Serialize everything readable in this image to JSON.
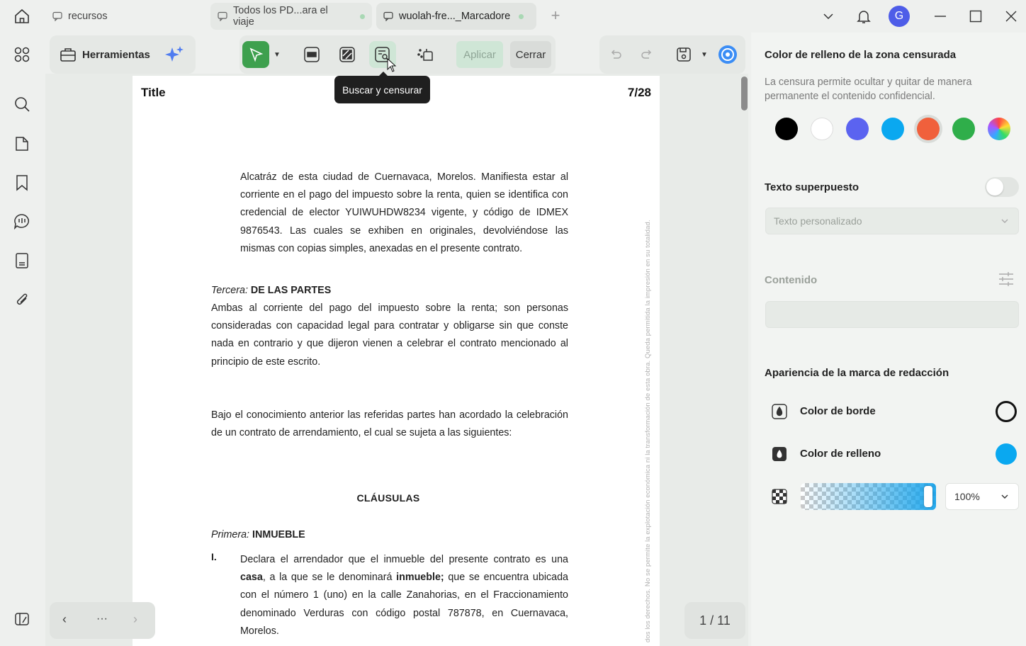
{
  "tabs": [
    {
      "label": "recursos"
    },
    {
      "label": "Todos los PD...ara el viaje"
    },
    {
      "label": "wuolah-fre..._Marcadore"
    }
  ],
  "user": {
    "avatar_letter": "G"
  },
  "toolbar": {
    "tools_label": "Herramientas",
    "apply_label": "Aplicar",
    "close_label": "Cerrar",
    "tooltip": "Buscar y censurar"
  },
  "document": {
    "header_title": "Title",
    "header_page": "7/28",
    "p1": "Alcatráz de esta ciudad de Cuernavaca, Morelos. Manifiesta estar al corriente en el pago del impuesto sobre la renta, quien se identifica con credencial de elector YUIWUHDW8234 vigente, y código de IDMEX 9876543. Las cuales se exhiben en originales, devolviéndose las mismas con copias simples, anexadas en el presente contrato.",
    "tercera_italic": "Tercera:",
    "tercera_bold": "DE LAS PARTES",
    "p2": "Ambas al corriente del pago del impuesto sobre la renta; son personas consideradas con capacidad legal para contratar y obligarse sin que conste nada en contrario y que dijeron vienen a celebrar el contrato mencionado al principio de este escrito.",
    "p3": "Bajo el conocimiento anterior las referidas partes han acordado la celebración de un contrato de arrendamiento, el cual se sujeta a las siguientes:",
    "clausulas": "CLÁUSULAS",
    "primera_italic": "Primera:",
    "primera_bold": "INMUEBLE",
    "item_num": "I.",
    "p5_a": "Declara el arrendador que el inmueble del presente contrato es una ",
    "p5_b": "casa",
    "p5_c": ", a la que se le denominará ",
    "p5_d": "inmueble;",
    "p5_e": " que se encuentra ubicada con el número 1 (uno) en la calle Zanahorias, en el Fraccionamiento denominado Verduras con código postal 787878, en Cuernavaca, Morelos.",
    "vertical_note": "dos los derechos. No se permite la explotación económica ni la transformación de esta obra. Queda permitida la impresión en su totalidad."
  },
  "navigation": {
    "prev": "‹",
    "more": "···",
    "next": "›",
    "page_indicator": "1 / 11"
  },
  "panel": {
    "fill_heading": "Color de relleno de la zona censurada",
    "fill_description": "La censura permite ocultar y quitar de manera permanente el contenido confidencial.",
    "swatches": [
      "#000000",
      "#ffffff",
      "#5b63f0",
      "#0aa8f0",
      "#f0603c",
      "#2fae4a",
      "rainbow"
    ],
    "selected_swatch": "#f0603c",
    "overlay_heading": "Texto superpuesto",
    "overlay_placeholder": "Texto personalizado",
    "content_heading": "Contenido",
    "appearance_heading": "Apariencia de la marca de redacción",
    "border_label": "Color de borde",
    "fill_label": "Color de relleno",
    "border_color": "#111111",
    "fill_color": "#0aa8f0",
    "opacity_value": "100%"
  }
}
